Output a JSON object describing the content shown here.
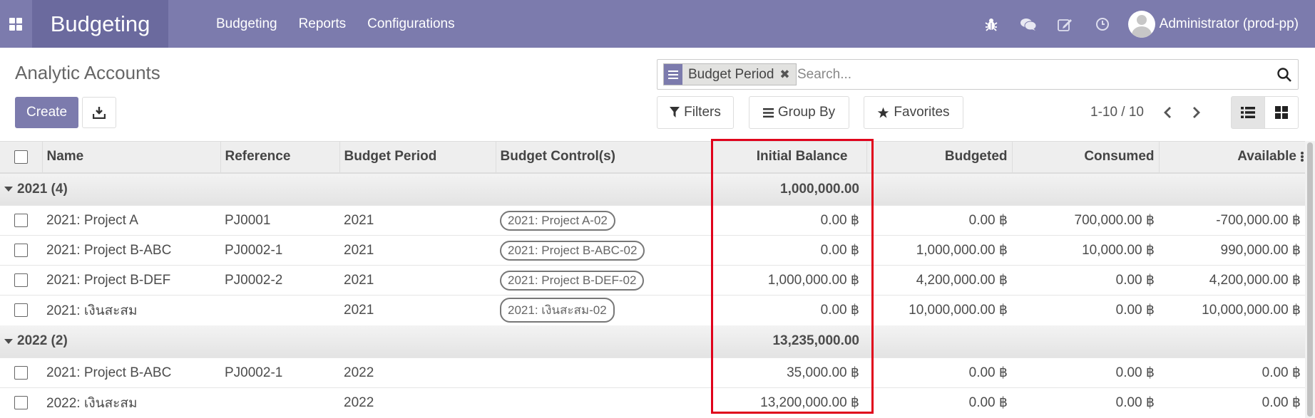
{
  "navbar": {
    "app_name": "Budgeting",
    "menu": [
      "Budgeting",
      "Reports",
      "Configurations"
    ],
    "user": "Administrator (prod-pp)",
    "icons": [
      "bug-icon",
      "chat-icon",
      "edit-icon",
      "clock-icon"
    ]
  },
  "control_panel": {
    "title": "Analytic Accounts",
    "create_label": "Create",
    "search": {
      "facet_value": "Budget Period",
      "placeholder": "Search..."
    },
    "filters_label": "Filters",
    "group_by_label": "Group By",
    "favorites_label": "Favorites",
    "pager": "1-10 / 10"
  },
  "table": {
    "columns": [
      "Name",
      "Reference",
      "Budget Period",
      "Budget Control(s)",
      "Initial Balance",
      "Budgeted",
      "Consumed",
      "Available"
    ],
    "groups": [
      {
        "label": "2021 (4)",
        "initial_balance": "1,000,000.00",
        "rows": [
          {
            "name": "2021: Project A",
            "reference": "PJ0001",
            "period": "2021",
            "control": "2021: Project A-02",
            "initial": "0.00 ฿",
            "budgeted": "0.00 ฿",
            "consumed": "700,000.00 ฿",
            "available": "-700,000.00 ฿"
          },
          {
            "name": "2021: Project B-ABC",
            "reference": "PJ0002-1",
            "period": "2021",
            "control": "2021: Project B-ABC-02",
            "initial": "0.00 ฿",
            "budgeted": "1,000,000.00 ฿",
            "consumed": "10,000.00 ฿",
            "available": "990,000.00 ฿"
          },
          {
            "name": "2021: Project B-DEF",
            "reference": "PJ0002-2",
            "period": "2021",
            "control": "2021: Project B-DEF-02",
            "initial": "1,000,000.00 ฿",
            "budgeted": "4,200,000.00 ฿",
            "consumed": "0.00 ฿",
            "available": "4,200,000.00 ฿"
          },
          {
            "name": "2021: เงินสะสม",
            "reference": "",
            "period": "2021",
            "control": "2021: เงินสะสม-02",
            "initial": "0.00 ฿",
            "budgeted": "10,000,000.00 ฿",
            "consumed": "0.00 ฿",
            "available": "10,000,000.00 ฿"
          }
        ]
      },
      {
        "label": "2022 (2)",
        "initial_balance": "13,235,000.00",
        "rows": [
          {
            "name": "2021: Project B-ABC",
            "reference": "PJ0002-1",
            "period": "2022",
            "control": "",
            "initial": "35,000.00 ฿",
            "budgeted": "0.00 ฿",
            "consumed": "0.00 ฿",
            "available": "0.00 ฿"
          },
          {
            "name": "2022: เงินสะสม",
            "reference": "",
            "period": "2022",
            "control": "",
            "initial": "13,200,000.00 ฿",
            "budgeted": "0.00 ฿",
            "consumed": "0.00 ฿",
            "available": "0.00 ฿"
          }
        ]
      }
    ]
  },
  "colors": {
    "navbar": "#7c7bad",
    "brand": "#6b6a9e",
    "highlight": "#e0001b"
  }
}
